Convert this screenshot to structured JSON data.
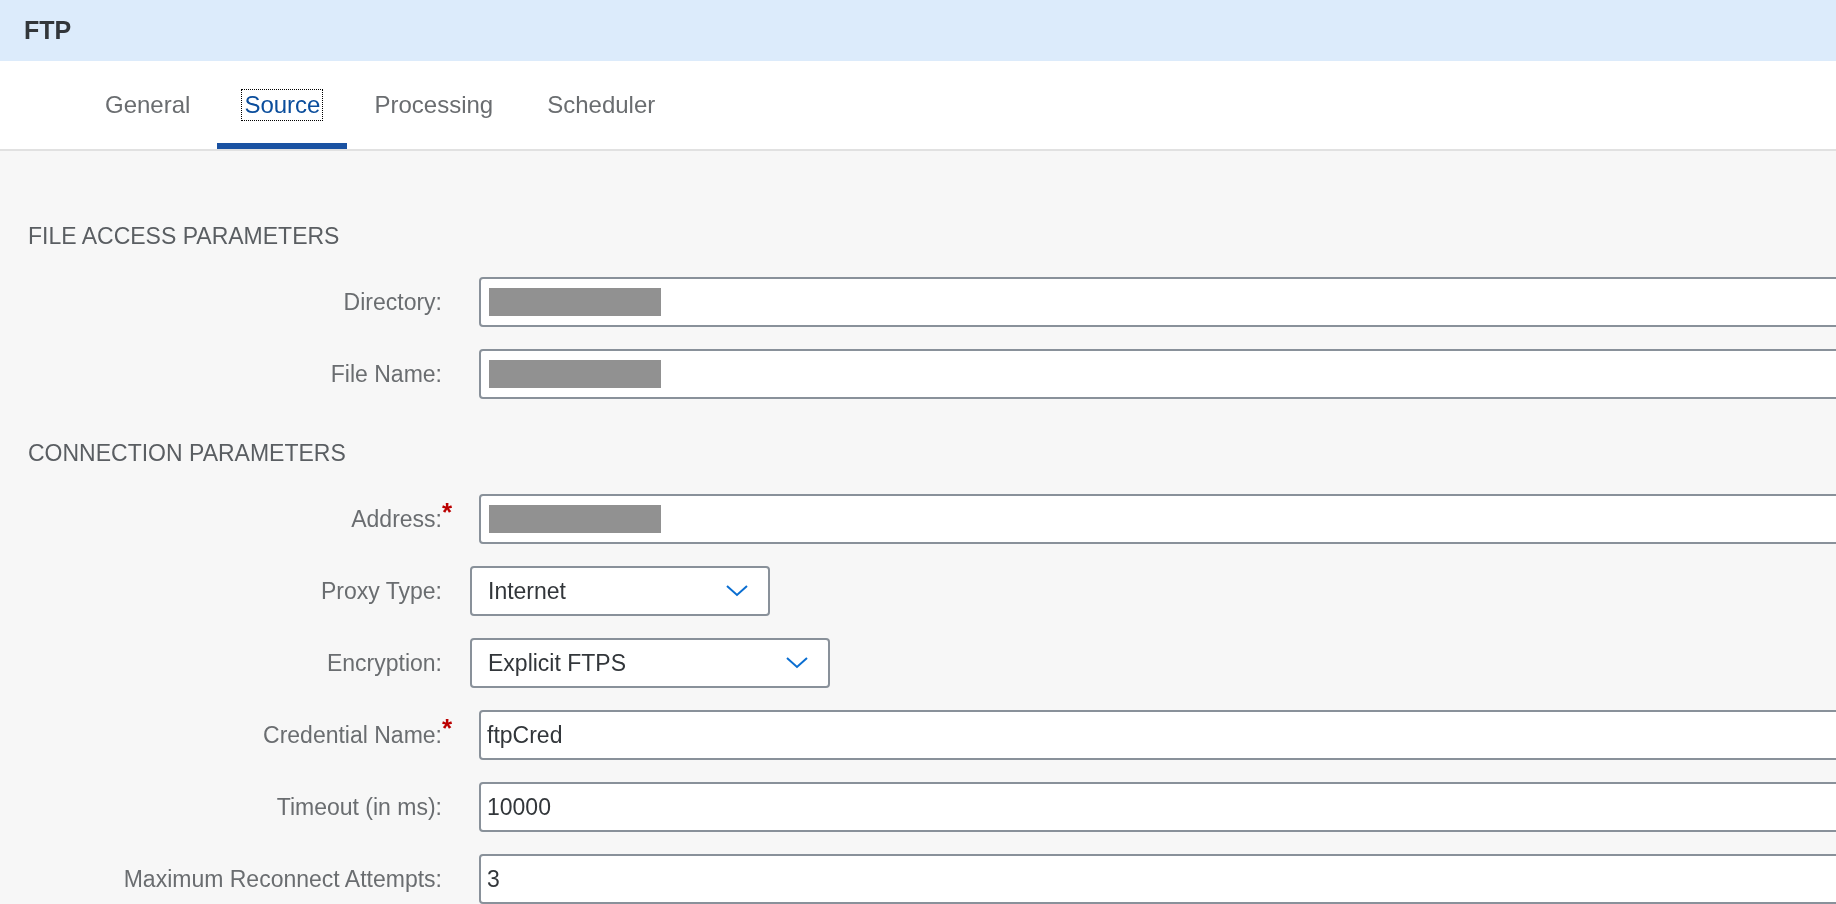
{
  "header": {
    "title": "FTP"
  },
  "tabs": [
    {
      "label": "General",
      "selected": false
    },
    {
      "label": "Source",
      "selected": true
    },
    {
      "label": "Processing",
      "selected": false
    },
    {
      "label": "Scheduler",
      "selected": false
    }
  ],
  "sections": [
    {
      "title": "FILE ACCESS PARAMETERS",
      "fields": [
        {
          "kind": "input",
          "label": "Directory:",
          "redacted": true
        },
        {
          "kind": "input",
          "label": "File Name:",
          "redacted": true
        }
      ]
    },
    {
      "title": "CONNECTION PARAMETERS",
      "fields": [
        {
          "kind": "input",
          "label": "Address:",
          "required_mark": "*",
          "redacted": true
        },
        {
          "kind": "select",
          "label": "Proxy Type:",
          "value": "Internet"
        },
        {
          "kind": "select",
          "label": "Encryption:",
          "value": "Explicit FTPS"
        },
        {
          "kind": "input",
          "label": "Credential Name:",
          "required_mark": "*",
          "value": "ftpCred"
        },
        {
          "kind": "input",
          "label": "Timeout (in ms):",
          "value": "10000"
        },
        {
          "kind": "input",
          "label": "Maximum Reconnect Attempts:",
          "value": "3"
        }
      ]
    }
  ]
}
